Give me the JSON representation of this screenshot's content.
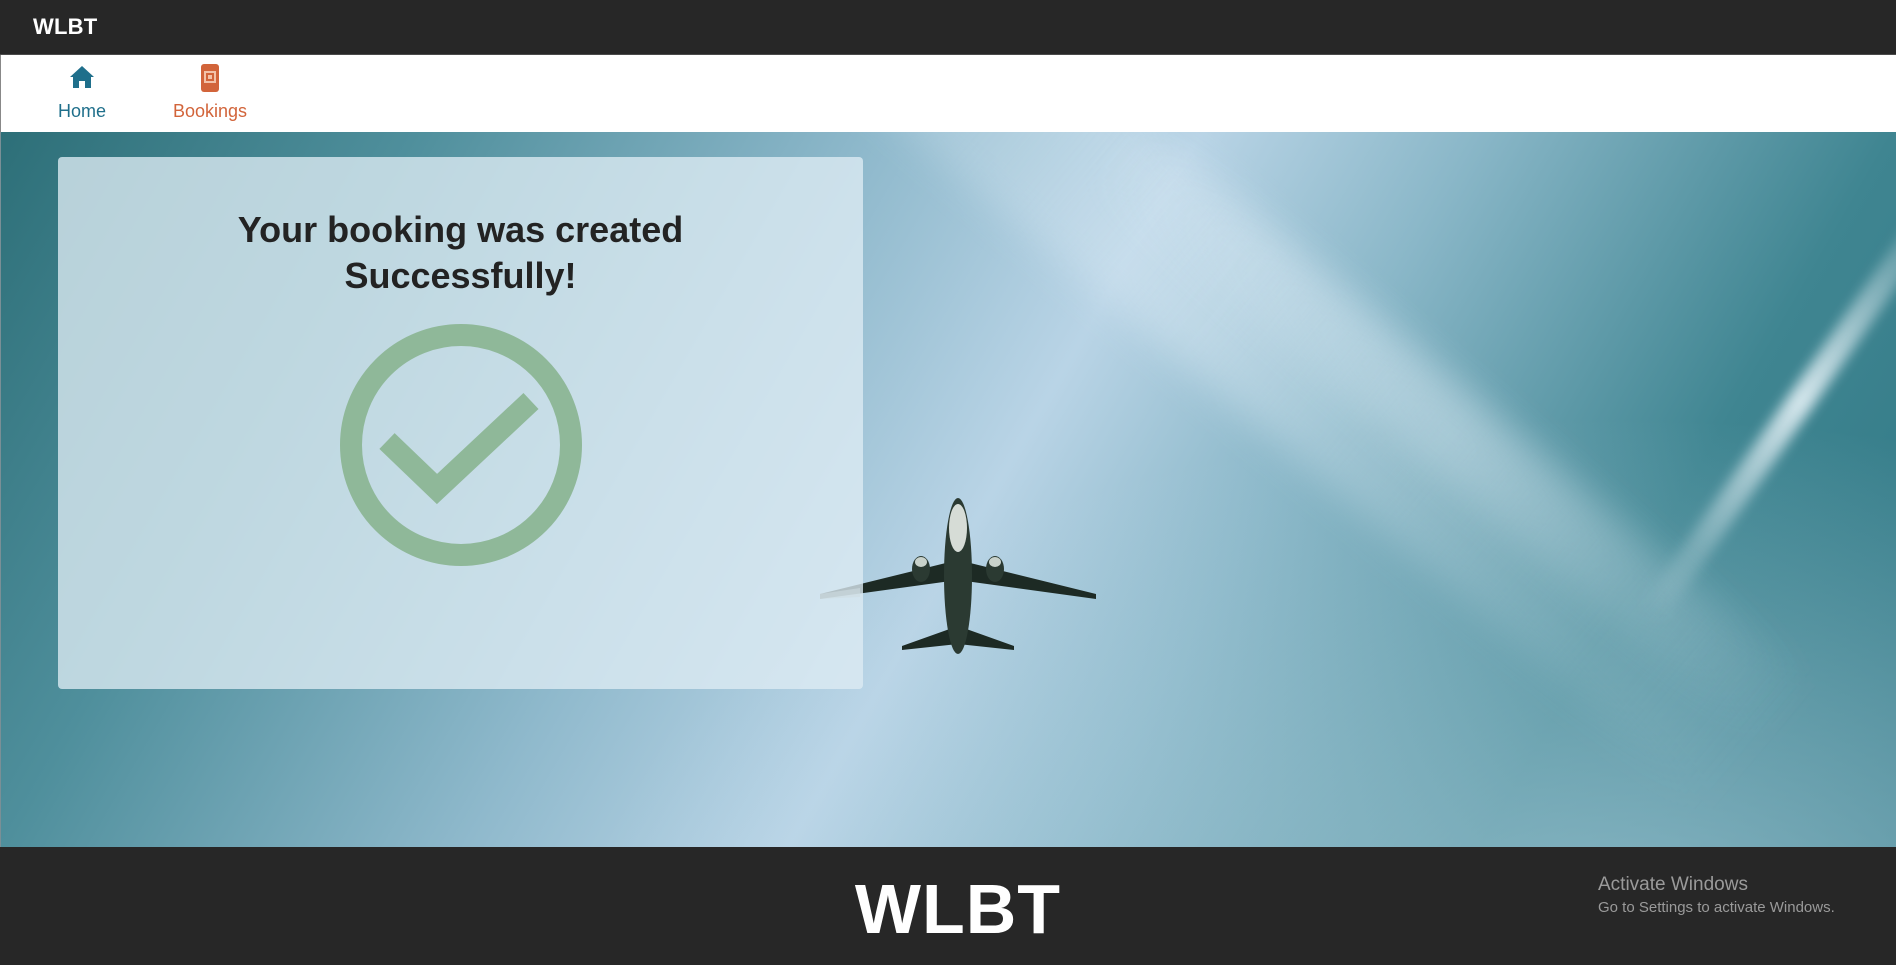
{
  "app": {
    "brand": "WLBT"
  },
  "nav": {
    "items": [
      {
        "label": "Home",
        "icon": "home-icon",
        "color": "#1f6f8b"
      },
      {
        "label": "Bookings",
        "icon": "bookings-icon",
        "color": "#d2643a"
      }
    ]
  },
  "card": {
    "title_line1": "Your booking was created",
    "title_line2": "Successfully!",
    "icon": "check-circle-icon",
    "icon_color": "#8fb899"
  },
  "footer": {
    "brand": "WLBT"
  },
  "watermark": {
    "line1": "Activate Windows",
    "line2": "Go to Settings to activate Windows."
  }
}
